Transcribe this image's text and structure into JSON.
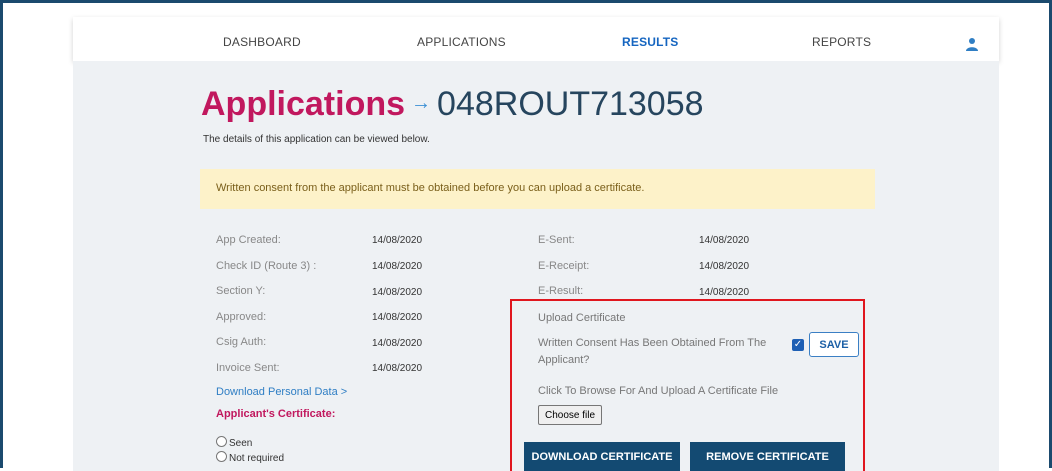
{
  "nav": {
    "items": [
      "DASHBOARD",
      "APPLICATIONS",
      "RESULTS",
      "REPORTS"
    ],
    "active": "RESULTS",
    "user_icon": "user-icon"
  },
  "page": {
    "title": "Applications",
    "arrow": "→",
    "app_id": "048ROUT713058",
    "subtitle": "The details of this application can be viewed below."
  },
  "alert": {
    "text": "Written consent from the applicant must be obtained before you can upload a certificate.",
    "color": "#fdf2c9"
  },
  "details_left": [
    {
      "label": "App Created:",
      "value": "14/08/2020"
    },
    {
      "label": "Check ID (Route 3) :",
      "value": "14/08/2020"
    },
    {
      "label": "Section Y:",
      "value": "14/08/2020"
    },
    {
      "label": "Approved:",
      "value": "14/08/2020"
    },
    {
      "label": "Csig Auth:",
      "value": "14/08/2020"
    },
    {
      "label": "Invoice Sent:",
      "value": "14/08/2020"
    }
  ],
  "details_right": [
    {
      "label": "E-Sent:",
      "value": "14/08/2020"
    },
    {
      "label": "E-Receipt:",
      "value": "14/08/2020"
    },
    {
      "label": "E-Result:",
      "value": "14/08/2020"
    }
  ],
  "download_link": "Download Personal Data >",
  "certificate": {
    "title": "Applicant's Certificate:",
    "options": [
      "Seen",
      "Not required"
    ]
  },
  "upload": {
    "title": "Upload Certificate",
    "consent_line1": "Written Consent Has Been Obtained From The",
    "consent_line2": "Applicant?",
    "consent_checked": true,
    "save_label": "SAVE",
    "browse_text": "Click To Browse For And Upload A Certificate File",
    "choose_file_label": "Choose file",
    "download_label": "DOWNLOAD CERTIFICATE",
    "remove_label": "REMOVE CERTIFICATE",
    "highlight_color": "#e0161e"
  }
}
